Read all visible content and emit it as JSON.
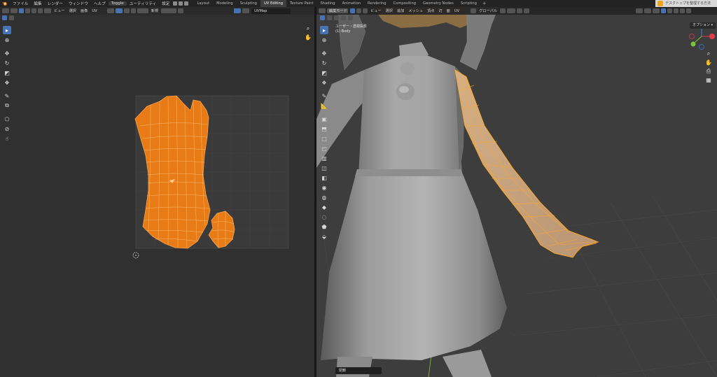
{
  "topbar": {
    "menus": [
      "ファイル",
      "編集",
      "レンダー",
      "ウィンドウ",
      "ヘルプ",
      "Toggle",
      "ユーティリティ",
      "設定"
    ],
    "active_menu": "Toggle",
    "workspaces": [
      "Layout",
      "Modeling",
      "Sculpting",
      "UV Editing",
      "Texture Paint",
      "Shading",
      "Animation",
      "Rendering",
      "Compositing",
      "Geometry Nodes",
      "Scripting"
    ],
    "active_workspace": "UV Editing",
    "add_tab": "+",
    "new_label": "新規",
    "notification": "デスクトップを整理する方法"
  },
  "uv_editor": {
    "view_menu": "ビュー",
    "select_menu": "選択",
    "image_menu": "画像",
    "uv_menu": "UV",
    "uvmap_field": "UVMap",
    "tools": [
      "select-icon",
      "cursor-icon",
      "move-icon",
      "rotate-icon",
      "scale-icon",
      "transform-icon",
      "annotate-icon",
      "rip-icon",
      "grab-icon",
      "relax-icon",
      "pinch-icon"
    ],
    "nav": [
      "zoom-icon",
      "hand-icon"
    ]
  },
  "viewport": {
    "mode_label": "編集モード",
    "view_menu": "ビュー",
    "select_menu": "選択",
    "add_menu": "追加",
    "mesh_menu": "メッシュ",
    "vertex_menu": "頂点",
    "edge_menu": "辺",
    "face_menu": "面",
    "uv_menu": "UV",
    "orientation": "グローバル",
    "options_label": "オプション",
    "overlay_line1": "ユーザー・透視投影",
    "overlay_line2": "(1) Body",
    "footer_label": "閉鎖",
    "colors": {
      "selected_edge": "#ffa726",
      "uv_face": "#e87b16",
      "axis_x": "#e03c4a",
      "axis_y": "#7bc23f",
      "axis_z": "#3a7de0"
    }
  }
}
